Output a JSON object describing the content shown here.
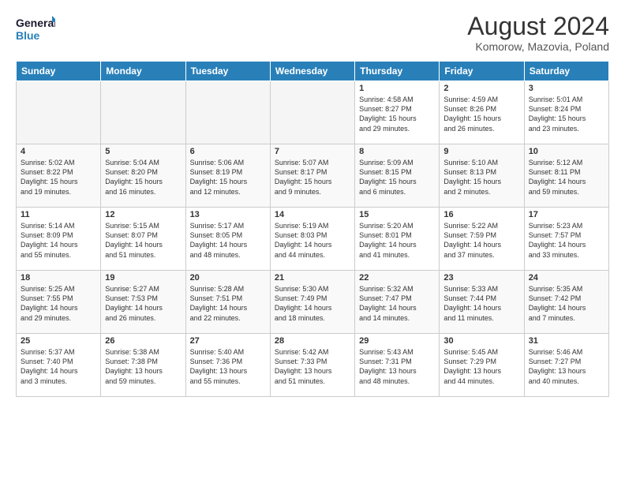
{
  "header": {
    "logo_line1": "General",
    "logo_line2": "Blue",
    "month_year": "August 2024",
    "location": "Komorow, Mazovia, Poland"
  },
  "weekdays": [
    "Sunday",
    "Monday",
    "Tuesday",
    "Wednesday",
    "Thursday",
    "Friday",
    "Saturday"
  ],
  "weeks": [
    [
      {
        "day": "",
        "content": ""
      },
      {
        "day": "",
        "content": ""
      },
      {
        "day": "",
        "content": ""
      },
      {
        "day": "",
        "content": ""
      },
      {
        "day": "1",
        "content": "Sunrise: 4:58 AM\nSunset: 8:27 PM\nDaylight: 15 hours\nand 29 minutes."
      },
      {
        "day": "2",
        "content": "Sunrise: 4:59 AM\nSunset: 8:26 PM\nDaylight: 15 hours\nand 26 minutes."
      },
      {
        "day": "3",
        "content": "Sunrise: 5:01 AM\nSunset: 8:24 PM\nDaylight: 15 hours\nand 23 minutes."
      }
    ],
    [
      {
        "day": "4",
        "content": "Sunrise: 5:02 AM\nSunset: 8:22 PM\nDaylight: 15 hours\nand 19 minutes."
      },
      {
        "day": "5",
        "content": "Sunrise: 5:04 AM\nSunset: 8:20 PM\nDaylight: 15 hours\nand 16 minutes."
      },
      {
        "day": "6",
        "content": "Sunrise: 5:06 AM\nSunset: 8:19 PM\nDaylight: 15 hours\nand 12 minutes."
      },
      {
        "day": "7",
        "content": "Sunrise: 5:07 AM\nSunset: 8:17 PM\nDaylight: 15 hours\nand 9 minutes."
      },
      {
        "day": "8",
        "content": "Sunrise: 5:09 AM\nSunset: 8:15 PM\nDaylight: 15 hours\nand 6 minutes."
      },
      {
        "day": "9",
        "content": "Sunrise: 5:10 AM\nSunset: 8:13 PM\nDaylight: 15 hours\nand 2 minutes."
      },
      {
        "day": "10",
        "content": "Sunrise: 5:12 AM\nSunset: 8:11 PM\nDaylight: 14 hours\nand 59 minutes."
      }
    ],
    [
      {
        "day": "11",
        "content": "Sunrise: 5:14 AM\nSunset: 8:09 PM\nDaylight: 14 hours\nand 55 minutes."
      },
      {
        "day": "12",
        "content": "Sunrise: 5:15 AM\nSunset: 8:07 PM\nDaylight: 14 hours\nand 51 minutes."
      },
      {
        "day": "13",
        "content": "Sunrise: 5:17 AM\nSunset: 8:05 PM\nDaylight: 14 hours\nand 48 minutes."
      },
      {
        "day": "14",
        "content": "Sunrise: 5:19 AM\nSunset: 8:03 PM\nDaylight: 14 hours\nand 44 minutes."
      },
      {
        "day": "15",
        "content": "Sunrise: 5:20 AM\nSunset: 8:01 PM\nDaylight: 14 hours\nand 41 minutes."
      },
      {
        "day": "16",
        "content": "Sunrise: 5:22 AM\nSunset: 7:59 PM\nDaylight: 14 hours\nand 37 minutes."
      },
      {
        "day": "17",
        "content": "Sunrise: 5:23 AM\nSunset: 7:57 PM\nDaylight: 14 hours\nand 33 minutes."
      }
    ],
    [
      {
        "day": "18",
        "content": "Sunrise: 5:25 AM\nSunset: 7:55 PM\nDaylight: 14 hours\nand 29 minutes."
      },
      {
        "day": "19",
        "content": "Sunrise: 5:27 AM\nSunset: 7:53 PM\nDaylight: 14 hours\nand 26 minutes."
      },
      {
        "day": "20",
        "content": "Sunrise: 5:28 AM\nSunset: 7:51 PM\nDaylight: 14 hours\nand 22 minutes."
      },
      {
        "day": "21",
        "content": "Sunrise: 5:30 AM\nSunset: 7:49 PM\nDaylight: 14 hours\nand 18 minutes."
      },
      {
        "day": "22",
        "content": "Sunrise: 5:32 AM\nSunset: 7:47 PM\nDaylight: 14 hours\nand 14 minutes."
      },
      {
        "day": "23",
        "content": "Sunrise: 5:33 AM\nSunset: 7:44 PM\nDaylight: 14 hours\nand 11 minutes."
      },
      {
        "day": "24",
        "content": "Sunrise: 5:35 AM\nSunset: 7:42 PM\nDaylight: 14 hours\nand 7 minutes."
      }
    ],
    [
      {
        "day": "25",
        "content": "Sunrise: 5:37 AM\nSunset: 7:40 PM\nDaylight: 14 hours\nand 3 minutes."
      },
      {
        "day": "26",
        "content": "Sunrise: 5:38 AM\nSunset: 7:38 PM\nDaylight: 13 hours\nand 59 minutes."
      },
      {
        "day": "27",
        "content": "Sunrise: 5:40 AM\nSunset: 7:36 PM\nDaylight: 13 hours\nand 55 minutes."
      },
      {
        "day": "28",
        "content": "Sunrise: 5:42 AM\nSunset: 7:33 PM\nDaylight: 13 hours\nand 51 minutes."
      },
      {
        "day": "29",
        "content": "Sunrise: 5:43 AM\nSunset: 7:31 PM\nDaylight: 13 hours\nand 48 minutes."
      },
      {
        "day": "30",
        "content": "Sunrise: 5:45 AM\nSunset: 7:29 PM\nDaylight: 13 hours\nand 44 minutes."
      },
      {
        "day": "31",
        "content": "Sunrise: 5:46 AM\nSunset: 7:27 PM\nDaylight: 13 hours\nand 40 minutes."
      }
    ]
  ]
}
